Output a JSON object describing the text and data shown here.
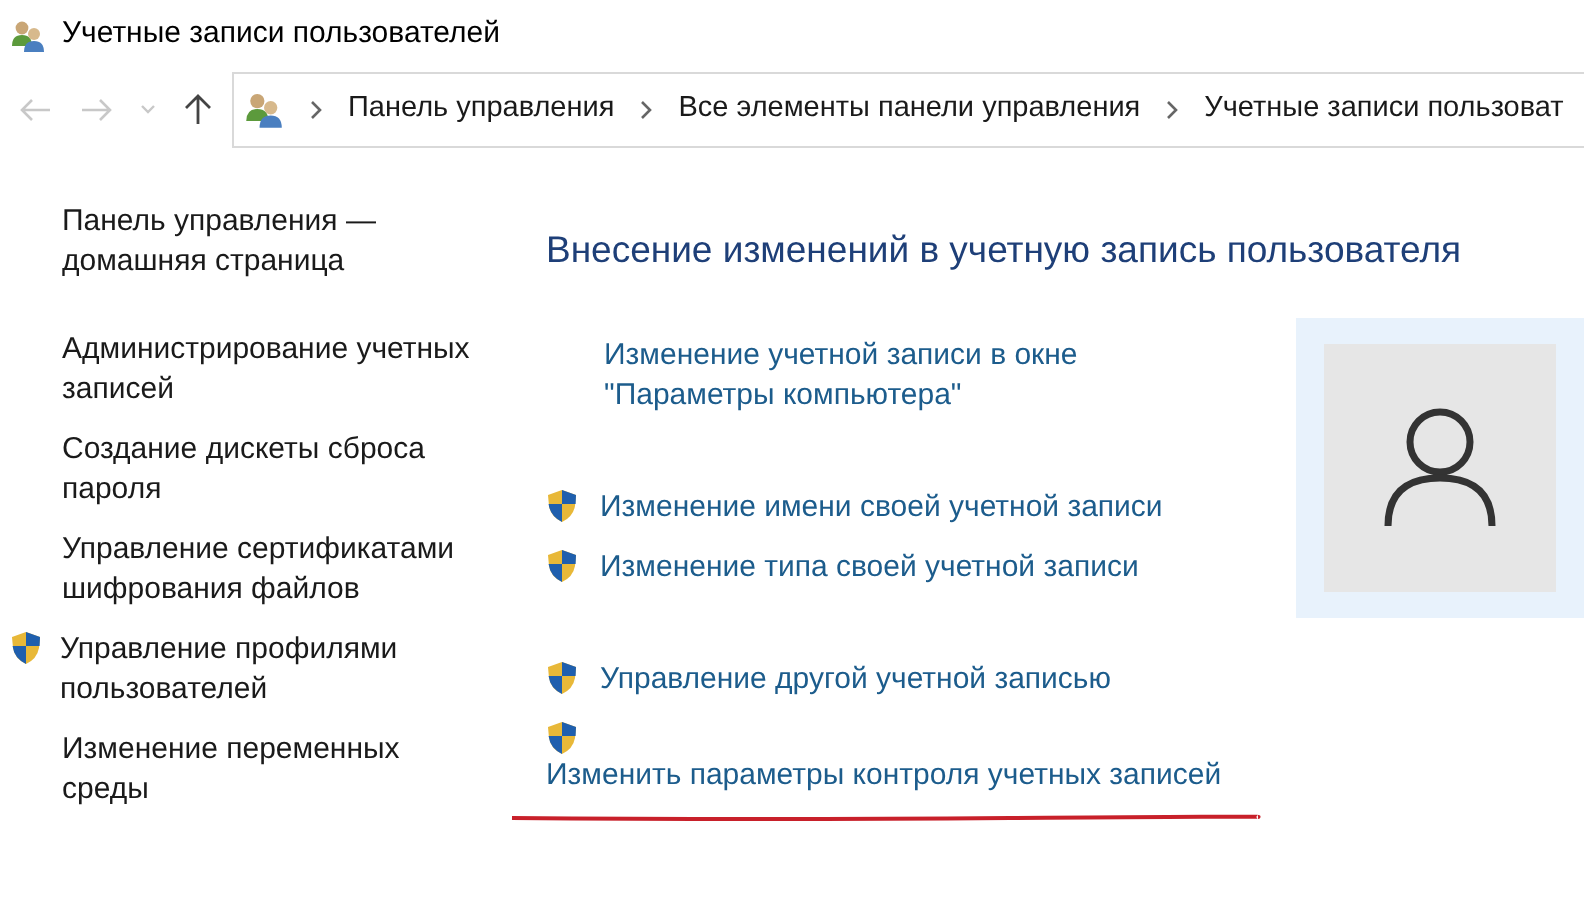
{
  "window": {
    "title": "Учетные записи пользователей"
  },
  "breadcrumb": [
    "Панель управления",
    "Все элементы панели управления",
    "Учетные записи пользоват"
  ],
  "sidebar": {
    "items": [
      {
        "label": "Панель управления —\nдомашняя страница",
        "shield": false
      },
      {
        "label": "Администрирование учетных\nзаписей",
        "shield": false
      },
      {
        "label": "Создание дискеты сброса\nпароля",
        "shield": false
      },
      {
        "label": "Управление сертификатами\nшифрования файлов",
        "shield": false
      },
      {
        "label": "Управление профилями\nпользователей",
        "shield": true
      },
      {
        "label": "Изменение переменных\nсреды",
        "shield": false
      }
    ]
  },
  "main": {
    "heading": "Внесение изменений в учетную запись пользователя",
    "groups": [
      [
        {
          "label": "Изменение учетной записи в окне\n\"Параметры компьютера\"",
          "shield": false,
          "kind": "inline"
        }
      ],
      [
        {
          "label": "Изменение имени своей учетной записи",
          "shield": true,
          "kind": "inline"
        },
        {
          "label": "Изменение типа своей учетной записи",
          "shield": true,
          "kind": "inline"
        }
      ],
      [
        {
          "label": "Управление другой учетной записью",
          "shield": true,
          "kind": "inline"
        },
        {
          "label": "Изменить параметры контроля учетных записей",
          "shield": true,
          "kind": "stacked"
        }
      ]
    ]
  }
}
